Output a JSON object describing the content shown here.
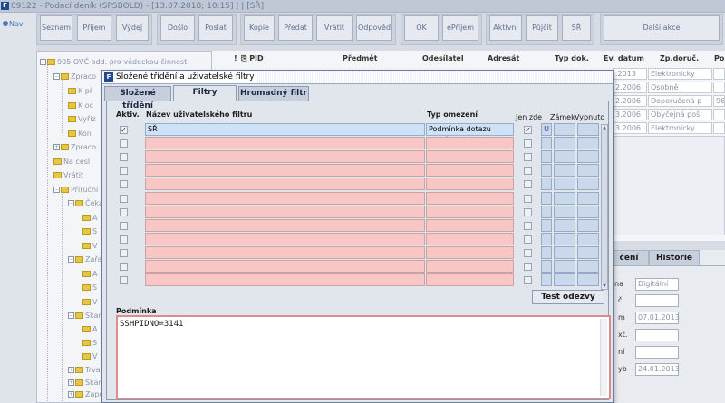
{
  "window": {
    "title": "09122 - Podací deník (SPSBOLD) - [13.07.2018; 10:15] | | [SŘ]",
    "icon_letter": "F"
  },
  "nav": {
    "label": "Nav"
  },
  "toolbar": {
    "buttons": [
      "Seznam",
      "Příjem",
      "Výdej",
      "Došlo",
      "Poslat",
      "Kopie",
      "Předat",
      "Vrátit",
      "Odpověď",
      "OK",
      "ePříjem",
      "Aktivní",
      "Půjčit",
      "SŘ",
      "Další akce"
    ]
  },
  "tree": {
    "items": [
      "905 OVČ odd. pro vědeckou činnost",
      "Zpraco",
      "K př",
      "K oc",
      "Vyřiz",
      "Kon",
      "Zpraco",
      "Na cesl",
      "Vrátit",
      "Příruční",
      "Čeka",
      "A",
      "S",
      "V",
      "Zařa",
      "A",
      "S",
      "V",
      "Skar",
      "A",
      "S",
      "V",
      "Trva",
      "Skar",
      "Zapo",
      "Skar"
    ]
  },
  "grid": {
    "headers": [
      "!",
      "PID",
      "Předmět",
      "Odesílatel",
      "Adresát",
      "Typ dok.",
      "Ev. datum",
      "Zp.doruč.",
      "Po"
    ],
    "ev_dates": [
      ".2013",
      "2.2006",
      "2.2006",
      "3.2006",
      "3.2006"
    ],
    "delivery": [
      "Elektronicky",
      "Osobně",
      "Doporučená p",
      "Obyčejná poš",
      "Elektronicky"
    ],
    "last_col": [
      "",
      "",
      "966",
      "",
      ""
    ]
  },
  "detail": {
    "tabs": [
      "čení",
      "Historie"
    ],
    "labels": [
      "na",
      "č.",
      "m",
      "xt.",
      "ní",
      "yb"
    ],
    "values": [
      "Digitální",
      "",
      "07.01.2013",
      "",
      "",
      "24.01.2013"
    ]
  },
  "dialog": {
    "title": "Složené třídění a uživatelské filtry",
    "tabs": [
      "Složené třídění",
      "Filtry",
      "Hromadný filtr"
    ],
    "active_tab": "Filtry",
    "columns": {
      "active": "Aktiv.",
      "name": "Název uživatelského filtru",
      "type": "Typ omezení",
      "only_here": "Jen zde",
      "lock": "Zámek",
      "off": "Vypnuto"
    },
    "rows": [
      {
        "active": "✓",
        "name": "SŘ",
        "type": "Podmínka dotazu volné",
        "only_here": "✓",
        "lock": "U",
        "off": ""
      },
      {
        "active": "",
        "name": "",
        "type": "",
        "only_here": "",
        "lock": "",
        "off": ""
      },
      {
        "active": "",
        "name": "",
        "type": "",
        "only_here": "",
        "lock": "",
        "off": ""
      },
      {
        "active": "",
        "name": "",
        "type": "",
        "only_here": "",
        "lock": "",
        "off": ""
      },
      {
        "active": "",
        "name": "",
        "type": "",
        "only_here": "",
        "lock": "",
        "off": ""
      },
      {
        "active": "",
        "name": "",
        "type": "",
        "only_here": "",
        "lock": "",
        "off": ""
      },
      {
        "active": "",
        "name": "",
        "type": "",
        "only_here": "",
        "lock": "",
        "off": ""
      },
      {
        "active": "",
        "name": "",
        "type": "",
        "only_here": "",
        "lock": "",
        "off": ""
      },
      {
        "active": "",
        "name": "",
        "type": "",
        "only_here": "",
        "lock": "",
        "off": ""
      },
      {
        "active": "",
        "name": "",
        "type": "",
        "only_here": "",
        "lock": "",
        "off": ""
      },
      {
        "active": "",
        "name": "",
        "type": "",
        "only_here": "",
        "lock": "",
        "off": ""
      },
      {
        "active": "",
        "name": "",
        "type": "",
        "only_here": "",
        "lock": "",
        "off": ""
      }
    ],
    "test_button": "Test odezvy",
    "condition_label": "Podmínka",
    "condition_value": "SSHPIDNO=3141"
  }
}
